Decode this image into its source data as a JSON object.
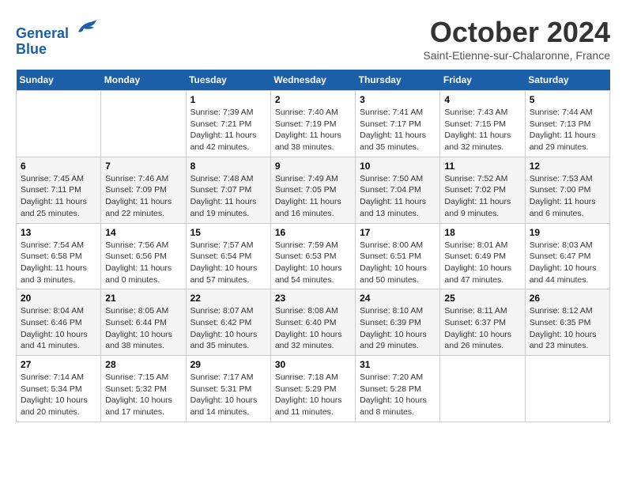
{
  "header": {
    "logo_line1": "General",
    "logo_line2": "Blue",
    "month_title": "October 2024",
    "location": "Saint-Etienne-sur-Chalaronne, France"
  },
  "days_of_week": [
    "Sunday",
    "Monday",
    "Tuesday",
    "Wednesday",
    "Thursday",
    "Friday",
    "Saturday"
  ],
  "weeks": [
    [
      {
        "day": "",
        "sunrise": "",
        "sunset": "",
        "daylight": ""
      },
      {
        "day": "",
        "sunrise": "",
        "sunset": "",
        "daylight": ""
      },
      {
        "day": "1",
        "sunrise": "Sunrise: 7:39 AM",
        "sunset": "Sunset: 7:21 PM",
        "daylight": "Daylight: 11 hours and 42 minutes."
      },
      {
        "day": "2",
        "sunrise": "Sunrise: 7:40 AM",
        "sunset": "Sunset: 7:19 PM",
        "daylight": "Daylight: 11 hours and 38 minutes."
      },
      {
        "day": "3",
        "sunrise": "Sunrise: 7:41 AM",
        "sunset": "Sunset: 7:17 PM",
        "daylight": "Daylight: 11 hours and 35 minutes."
      },
      {
        "day": "4",
        "sunrise": "Sunrise: 7:43 AM",
        "sunset": "Sunset: 7:15 PM",
        "daylight": "Daylight: 11 hours and 32 minutes."
      },
      {
        "day": "5",
        "sunrise": "Sunrise: 7:44 AM",
        "sunset": "Sunset: 7:13 PM",
        "daylight": "Daylight: 11 hours and 29 minutes."
      }
    ],
    [
      {
        "day": "6",
        "sunrise": "Sunrise: 7:45 AM",
        "sunset": "Sunset: 7:11 PM",
        "daylight": "Daylight: 11 hours and 25 minutes."
      },
      {
        "day": "7",
        "sunrise": "Sunrise: 7:46 AM",
        "sunset": "Sunset: 7:09 PM",
        "daylight": "Daylight: 11 hours and 22 minutes."
      },
      {
        "day": "8",
        "sunrise": "Sunrise: 7:48 AM",
        "sunset": "Sunset: 7:07 PM",
        "daylight": "Daylight: 11 hours and 19 minutes."
      },
      {
        "day": "9",
        "sunrise": "Sunrise: 7:49 AM",
        "sunset": "Sunset: 7:05 PM",
        "daylight": "Daylight: 11 hours and 16 minutes."
      },
      {
        "day": "10",
        "sunrise": "Sunrise: 7:50 AM",
        "sunset": "Sunset: 7:04 PM",
        "daylight": "Daylight: 11 hours and 13 minutes."
      },
      {
        "day": "11",
        "sunrise": "Sunrise: 7:52 AM",
        "sunset": "Sunset: 7:02 PM",
        "daylight": "Daylight: 11 hours and 9 minutes."
      },
      {
        "day": "12",
        "sunrise": "Sunrise: 7:53 AM",
        "sunset": "Sunset: 7:00 PM",
        "daylight": "Daylight: 11 hours and 6 minutes."
      }
    ],
    [
      {
        "day": "13",
        "sunrise": "Sunrise: 7:54 AM",
        "sunset": "Sunset: 6:58 PM",
        "daylight": "Daylight: 11 hours and 3 minutes."
      },
      {
        "day": "14",
        "sunrise": "Sunrise: 7:56 AM",
        "sunset": "Sunset: 6:56 PM",
        "daylight": "Daylight: 11 hours and 0 minutes."
      },
      {
        "day": "15",
        "sunrise": "Sunrise: 7:57 AM",
        "sunset": "Sunset: 6:54 PM",
        "daylight": "Daylight: 10 hours and 57 minutes."
      },
      {
        "day": "16",
        "sunrise": "Sunrise: 7:59 AM",
        "sunset": "Sunset: 6:53 PM",
        "daylight": "Daylight: 10 hours and 54 minutes."
      },
      {
        "day": "17",
        "sunrise": "Sunrise: 8:00 AM",
        "sunset": "Sunset: 6:51 PM",
        "daylight": "Daylight: 10 hours and 50 minutes."
      },
      {
        "day": "18",
        "sunrise": "Sunrise: 8:01 AM",
        "sunset": "Sunset: 6:49 PM",
        "daylight": "Daylight: 10 hours and 47 minutes."
      },
      {
        "day": "19",
        "sunrise": "Sunrise: 8:03 AM",
        "sunset": "Sunset: 6:47 PM",
        "daylight": "Daylight: 10 hours and 44 minutes."
      }
    ],
    [
      {
        "day": "20",
        "sunrise": "Sunrise: 8:04 AM",
        "sunset": "Sunset: 6:46 PM",
        "daylight": "Daylight: 10 hours and 41 minutes."
      },
      {
        "day": "21",
        "sunrise": "Sunrise: 8:05 AM",
        "sunset": "Sunset: 6:44 PM",
        "daylight": "Daylight: 10 hours and 38 minutes."
      },
      {
        "day": "22",
        "sunrise": "Sunrise: 8:07 AM",
        "sunset": "Sunset: 6:42 PM",
        "daylight": "Daylight: 10 hours and 35 minutes."
      },
      {
        "day": "23",
        "sunrise": "Sunrise: 8:08 AM",
        "sunset": "Sunset: 6:40 PM",
        "daylight": "Daylight: 10 hours and 32 minutes."
      },
      {
        "day": "24",
        "sunrise": "Sunrise: 8:10 AM",
        "sunset": "Sunset: 6:39 PM",
        "daylight": "Daylight: 10 hours and 29 minutes."
      },
      {
        "day": "25",
        "sunrise": "Sunrise: 8:11 AM",
        "sunset": "Sunset: 6:37 PM",
        "daylight": "Daylight: 10 hours and 26 minutes."
      },
      {
        "day": "26",
        "sunrise": "Sunrise: 8:12 AM",
        "sunset": "Sunset: 6:35 PM",
        "daylight": "Daylight: 10 hours and 23 minutes."
      }
    ],
    [
      {
        "day": "27",
        "sunrise": "Sunrise: 7:14 AM",
        "sunset": "Sunset: 5:34 PM",
        "daylight": "Daylight: 10 hours and 20 minutes."
      },
      {
        "day": "28",
        "sunrise": "Sunrise: 7:15 AM",
        "sunset": "Sunset: 5:32 PM",
        "daylight": "Daylight: 10 hours and 17 minutes."
      },
      {
        "day": "29",
        "sunrise": "Sunrise: 7:17 AM",
        "sunset": "Sunset: 5:31 PM",
        "daylight": "Daylight: 10 hours and 14 minutes."
      },
      {
        "day": "30",
        "sunrise": "Sunrise: 7:18 AM",
        "sunset": "Sunset: 5:29 PM",
        "daylight": "Daylight: 10 hours and 11 minutes."
      },
      {
        "day": "31",
        "sunrise": "Sunrise: 7:20 AM",
        "sunset": "Sunset: 5:28 PM",
        "daylight": "Daylight: 10 hours and 8 minutes."
      },
      {
        "day": "",
        "sunrise": "",
        "sunset": "",
        "daylight": ""
      },
      {
        "day": "",
        "sunrise": "",
        "sunset": "",
        "daylight": ""
      }
    ]
  ]
}
